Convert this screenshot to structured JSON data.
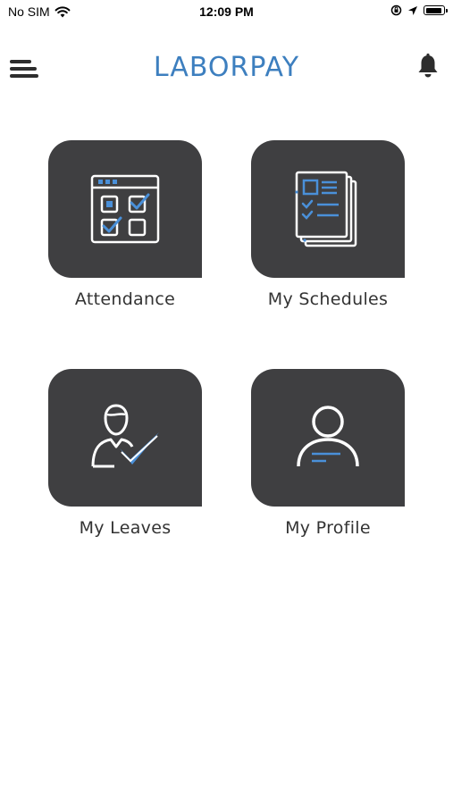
{
  "status_bar": {
    "carrier": "No SIM",
    "time": "12:09 PM",
    "icons": [
      "wifi-icon",
      "orientation-lock-icon",
      "location-arrow-icon",
      "battery-icon"
    ]
  },
  "header": {
    "title": "LABORPAY",
    "menu_icon": "hamburger-menu-icon",
    "notification_icon": "bell-icon"
  },
  "tiles": [
    {
      "label": "Attendance",
      "icon": "calendar-check-icon"
    },
    {
      "label": "My Schedules",
      "icon": "schedule-list-icon"
    },
    {
      "label": "My Leaves",
      "icon": "user-check-icon"
    },
    {
      "label": "My Profile",
      "icon": "profile-icon"
    }
  ],
  "colors": {
    "brand": "#3d7fbf",
    "tile_background": "#3f3f41",
    "icon_accent": "#4a90d9",
    "icon_line": "#ffffff"
  }
}
